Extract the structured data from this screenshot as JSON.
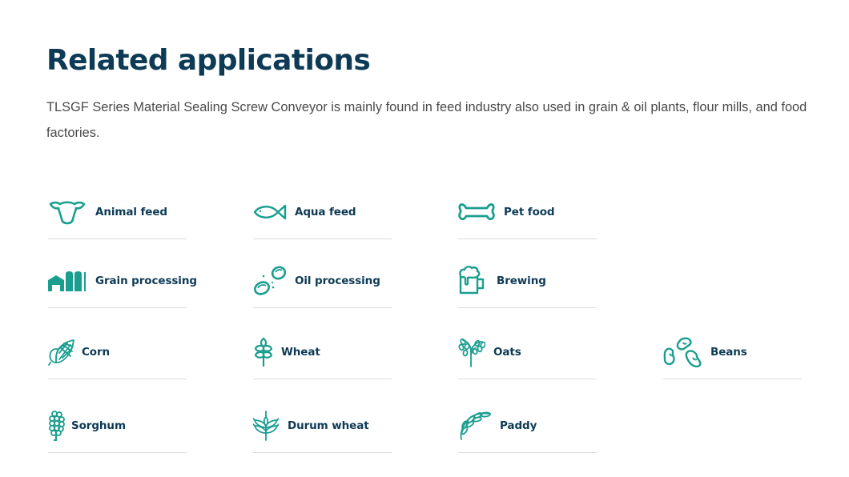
{
  "section": {
    "title": "Related applications",
    "description": "TLSGF Series Material Sealing Screw Conveyor is mainly found in feed industry also used in grain & oil plants, flour mills, and food factories."
  },
  "colors": {
    "heading": "#0d3a55",
    "icon_accent": "#1a9e8f",
    "body_text": "#4a4a4a",
    "divider": "#dcdcdc"
  },
  "applications": [
    {
      "label": "Animal feed",
      "icon": "cow-head-icon"
    },
    {
      "label": "Aqua feed",
      "icon": "fish-icon"
    },
    {
      "label": "Pet food",
      "icon": "bone-icon"
    },
    {
      "label": "Grain processing",
      "icon": "grain-silo-icon"
    },
    {
      "label": "Oil processing",
      "icon": "oil-drops-icon"
    },
    {
      "label": "Brewing",
      "icon": "beer-mug-icon"
    },
    {
      "label": "Corn",
      "icon": "corn-icon"
    },
    {
      "label": "Wheat",
      "icon": "wheat-icon"
    },
    {
      "label": "Oats",
      "icon": "oats-icon"
    },
    {
      "label": "Beans",
      "icon": "beans-icon"
    },
    {
      "label": "Sorghum",
      "icon": "sorghum-icon"
    },
    {
      "label": "Durum wheat",
      "icon": "durum-wheat-icon"
    },
    {
      "label": "Paddy",
      "icon": "paddy-icon"
    }
  ]
}
